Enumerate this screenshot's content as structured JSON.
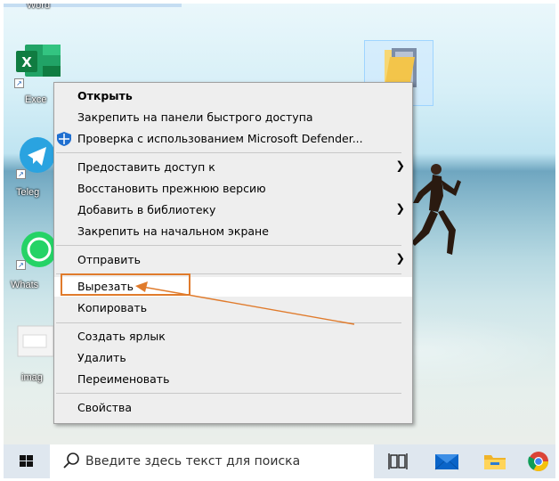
{
  "desktop": {
    "icons": [
      {
        "name": "word",
        "label": "Word"
      },
      {
        "name": "excel",
        "label": "Exce"
      },
      {
        "name": "telegram",
        "label": "Teleg"
      },
      {
        "name": "whatsapp",
        "label": "Whats"
      },
      {
        "name": "image",
        "label": "imag"
      }
    ]
  },
  "context_menu": {
    "items": [
      {
        "label": "Открыть",
        "bold": true
      },
      {
        "label": "Закрепить на панели быстрого доступа"
      },
      {
        "label": "Проверка с использованием Microsoft Defender...",
        "icon": "defender-shield-icon"
      },
      {
        "label": "Предоставить доступ к",
        "submenu": true
      },
      {
        "label": "Восстановить прежнюю версию"
      },
      {
        "label": "Добавить в библиотеку",
        "submenu": true
      },
      {
        "label": "Закрепить на начальном экране"
      },
      {
        "label": "Отправить",
        "submenu": true
      },
      {
        "label": "Вырезать",
        "highlighted": true
      },
      {
        "label": "Копировать"
      },
      {
        "label": "Создать ярлык"
      },
      {
        "label": "Удалить"
      },
      {
        "label": "Переименовать"
      },
      {
        "label": "Свойства"
      }
    ],
    "submenu_arrow": "❯"
  },
  "taskbar": {
    "search_placeholder": "Введите здесь текст для поиска",
    "icons": [
      "start-icon",
      "search-icon",
      "task-view-icon",
      "mail-icon",
      "file-explorer-icon",
      "chrome-icon"
    ]
  },
  "colors": {
    "annotation": "#e07b2c",
    "menu_bg": "#eeeeee",
    "highlight": "#ffffff",
    "taskbar": "#dfe7ef"
  }
}
